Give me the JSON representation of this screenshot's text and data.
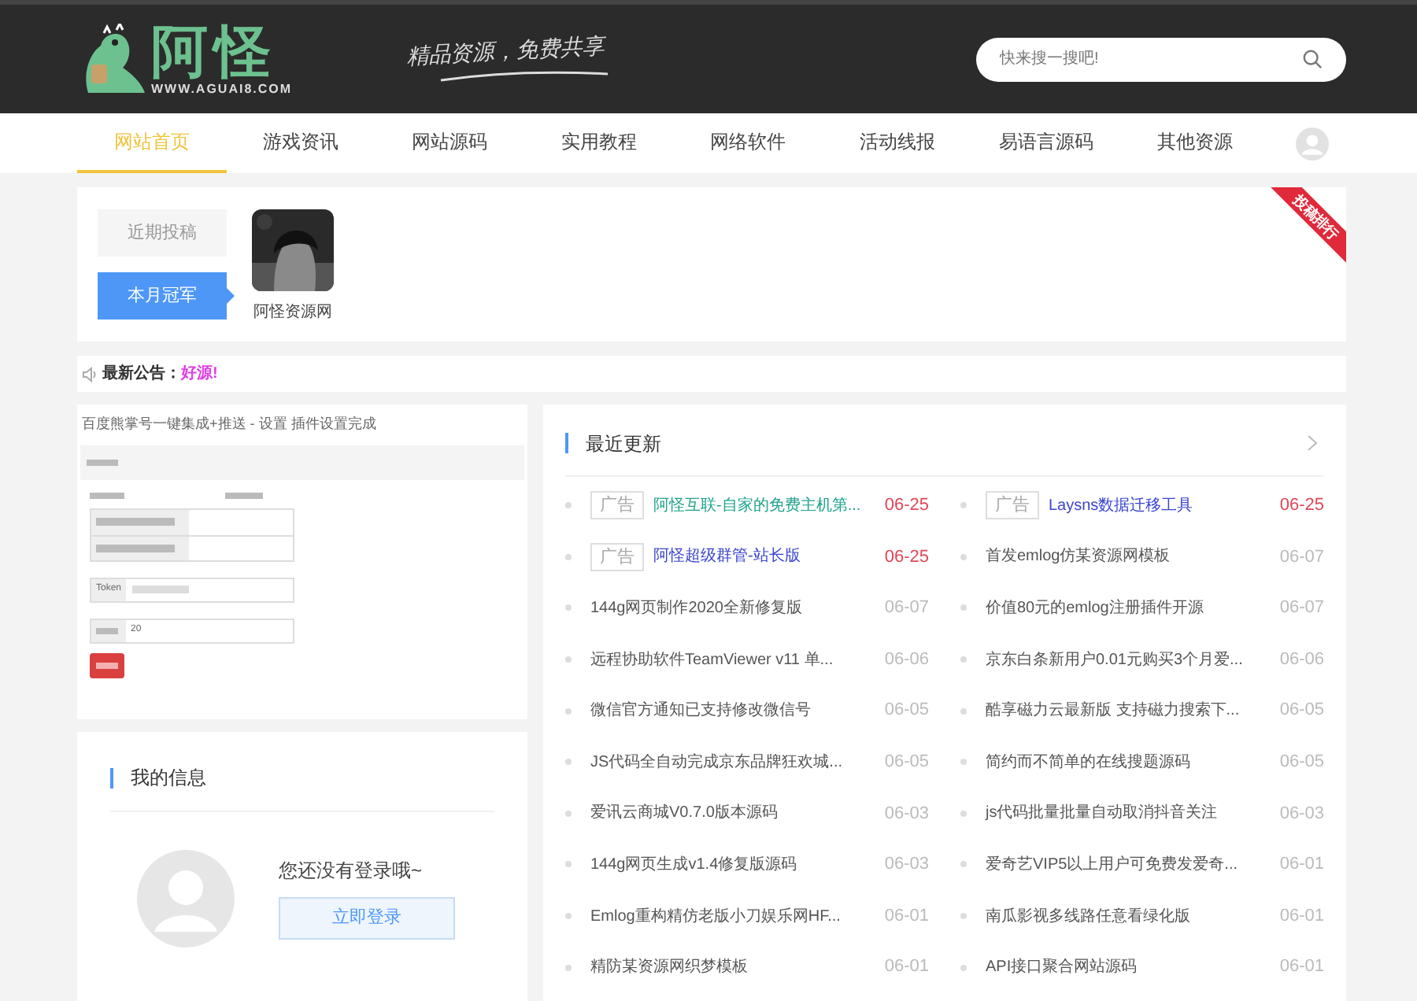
{
  "header": {
    "logo_text": "阿怪",
    "logo_url": "WWW.AGUAI8.COM",
    "slogan": "精品资源，免费共享",
    "search": {
      "placeholder": "快来搜一搜吧!"
    }
  },
  "nav": [
    {
      "label": "网站首页",
      "selected": true
    },
    {
      "label": "游戏资讯",
      "selected": false
    },
    {
      "label": "网站源码",
      "selected": false
    },
    {
      "label": "实用教程",
      "selected": false
    },
    {
      "label": "网络软件",
      "selected": false
    },
    {
      "label": "活动线报",
      "selected": false
    },
    {
      "label": "易语言源码",
      "selected": false
    },
    {
      "label": "其他资源",
      "selected": false
    }
  ],
  "ranking": {
    "tabs": [
      {
        "label": "近期投稿",
        "selected": false
      },
      {
        "label": "本月冠军",
        "selected": true
      }
    ],
    "user": "阿怪资源网",
    "ribbon": "投稿排行"
  },
  "notice": {
    "label": "最新公告：",
    "text": "好源!"
  },
  "plugin_shot": {
    "title": "百度熊掌号一键集成+推送 - 设置 插件设置完成",
    "token_label": "Token",
    "count_value": "20"
  },
  "my_info": {
    "title": "我的信息",
    "message": "您还没有登录哦~",
    "login_button": "立即登录"
  },
  "updates": {
    "title": "最近更新",
    "items": [
      {
        "kind": "ad",
        "tag": "广告",
        "title": "阿怪互联-自家的免费主机第...",
        "color": "#1fa38a",
        "date": "06-25",
        "highlighted": true
      },
      {
        "kind": "ad",
        "tag": "广告",
        "title": "Laysns数据迁移工具",
        "color": "#3b45d0",
        "date": "06-25",
        "highlighted": true
      },
      {
        "kind": "ad",
        "tag": "广告",
        "title": "阿怪超级群管-站长版",
        "color": "#3b45d0",
        "date": "06-25",
        "highlighted": true
      },
      {
        "kind": "normal",
        "title": "首发emlog仿某资源网模板",
        "date": "06-07",
        "highlighted": false
      },
      {
        "kind": "normal",
        "title": "144g网页制作2020全新修复版",
        "date": "06-07",
        "highlighted": false
      },
      {
        "kind": "normal",
        "title": "价值80元的emlog注册插件开源",
        "date": "06-07",
        "highlighted": false
      },
      {
        "kind": "normal",
        "title": "远程协助软件TeamViewer v11 单...",
        "date": "06-06",
        "highlighted": false
      },
      {
        "kind": "normal",
        "title": "京东白条新用户0.01元购买3个月爱...",
        "date": "06-06",
        "highlighted": false
      },
      {
        "kind": "normal",
        "title": "微信官方通知已支持修改微信号",
        "date": "06-05",
        "highlighted": false
      },
      {
        "kind": "normal",
        "title": "酷享磁力云最新版 支持磁力搜索下...",
        "date": "06-05",
        "highlighted": false
      },
      {
        "kind": "normal",
        "title": "JS代码全自动完成京东品牌狂欢城...",
        "date": "06-05",
        "highlighted": false
      },
      {
        "kind": "normal",
        "title": "简约而不简单的在线搜题源码",
        "date": "06-05",
        "highlighted": false
      },
      {
        "kind": "normal",
        "title": "爱讯云商城V0.7.0版本源码",
        "date": "06-03",
        "highlighted": false
      },
      {
        "kind": "normal",
        "title": "js代码批量批量自动取消抖音关注",
        "date": "06-03",
        "highlighted": false
      },
      {
        "kind": "normal",
        "title": "144g网页生成v1.4修复版源码",
        "date": "06-03",
        "highlighted": false
      },
      {
        "kind": "normal",
        "title": "爱奇艺VIP5以上用户可免费发爱奇...",
        "date": "06-01",
        "highlighted": false
      },
      {
        "kind": "normal",
        "title": "Emlog重构精仿老版小刀娱乐网HF...",
        "date": "06-01",
        "highlighted": false
      },
      {
        "kind": "normal",
        "title": "南瓜影视多线路任意看绿化版",
        "date": "06-01",
        "highlighted": false
      },
      {
        "kind": "normal",
        "title": "精防某资源网织梦模板",
        "date": "06-01",
        "highlighted": false
      },
      {
        "kind": "normal",
        "title": "API接口聚合网站源码",
        "date": "06-01",
        "highlighted": false
      }
    ]
  }
}
